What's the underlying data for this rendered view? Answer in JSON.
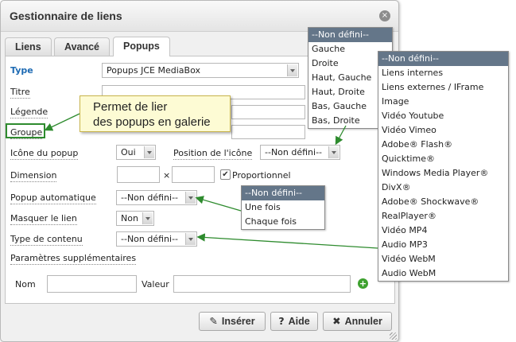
{
  "window": {
    "title": "Gestionnaire de liens",
    "close_label": "×"
  },
  "tabs": [
    {
      "label": "Liens"
    },
    {
      "label": "Avancé"
    },
    {
      "label": "Popups"
    }
  ],
  "form": {
    "type": {
      "label": "Type",
      "value": "Popups JCE MediaBox"
    },
    "titre": {
      "label": "Titre"
    },
    "legende": {
      "label": "Légende"
    },
    "groupe": {
      "label": "Groupe"
    },
    "icone": {
      "label": "Icône du popup",
      "value": "Oui"
    },
    "position_icone": {
      "label": "Position de l'icône",
      "value": "--Non défini--"
    },
    "dimension": {
      "label": "Dimension",
      "separator": "×",
      "proportionnel_label": "Proportionnel",
      "proportionnel_checked": true,
      "check_glyph": "✔"
    },
    "popup_auto": {
      "label": "Popup automatique",
      "value": "--Non défini--"
    },
    "masquer": {
      "label": "Masquer le lien",
      "value": "Non"
    },
    "type_contenu": {
      "label": "Type de contenu",
      "value": "--Non défini--"
    },
    "params": {
      "label": "Paramètres supplémentaires",
      "nom_label": "Nom",
      "valeur_label": "Valeur",
      "add_icon": "plus-icon",
      "add_glyph": "+"
    }
  },
  "buttons": {
    "inserer": {
      "label": "Insérer",
      "glyph": "✎"
    },
    "aide": {
      "label": "Aide",
      "glyph": "?"
    },
    "annuler": {
      "label": "Annuler",
      "glyph": "✖"
    }
  },
  "callout": {
    "line1": "Permet de lier",
    "line2": "des popups en galerie"
  },
  "dropdowns": {
    "position": [
      "--Non défini--",
      "Gauche",
      "Droite",
      "Haut, Gauche",
      "Haut, Droite",
      "Bas, Gauche",
      "Bas, Droite"
    ],
    "popup_auto": [
      "--Non défini--",
      "Une fois",
      "Chaque fois"
    ],
    "type_contenu": [
      "--Non défini--",
      "Liens internes",
      "Liens externes / IFrame",
      "Image",
      "Vidéo Youtube",
      "Vidéo Vimeo",
      "Adobe® Flash®",
      "Quicktime®",
      "Windows Media Player®",
      "DivX®",
      "Adobe® Shockwave®",
      "RealPlayer®",
      "Vidéo MP4",
      "Audio MP3",
      "Vidéo WebM",
      "Audio WebM"
    ]
  },
  "colors": {
    "annotation_green": "#2e8b2e",
    "selected_option": "#647689",
    "label_blue": "#1d6ab3"
  }
}
